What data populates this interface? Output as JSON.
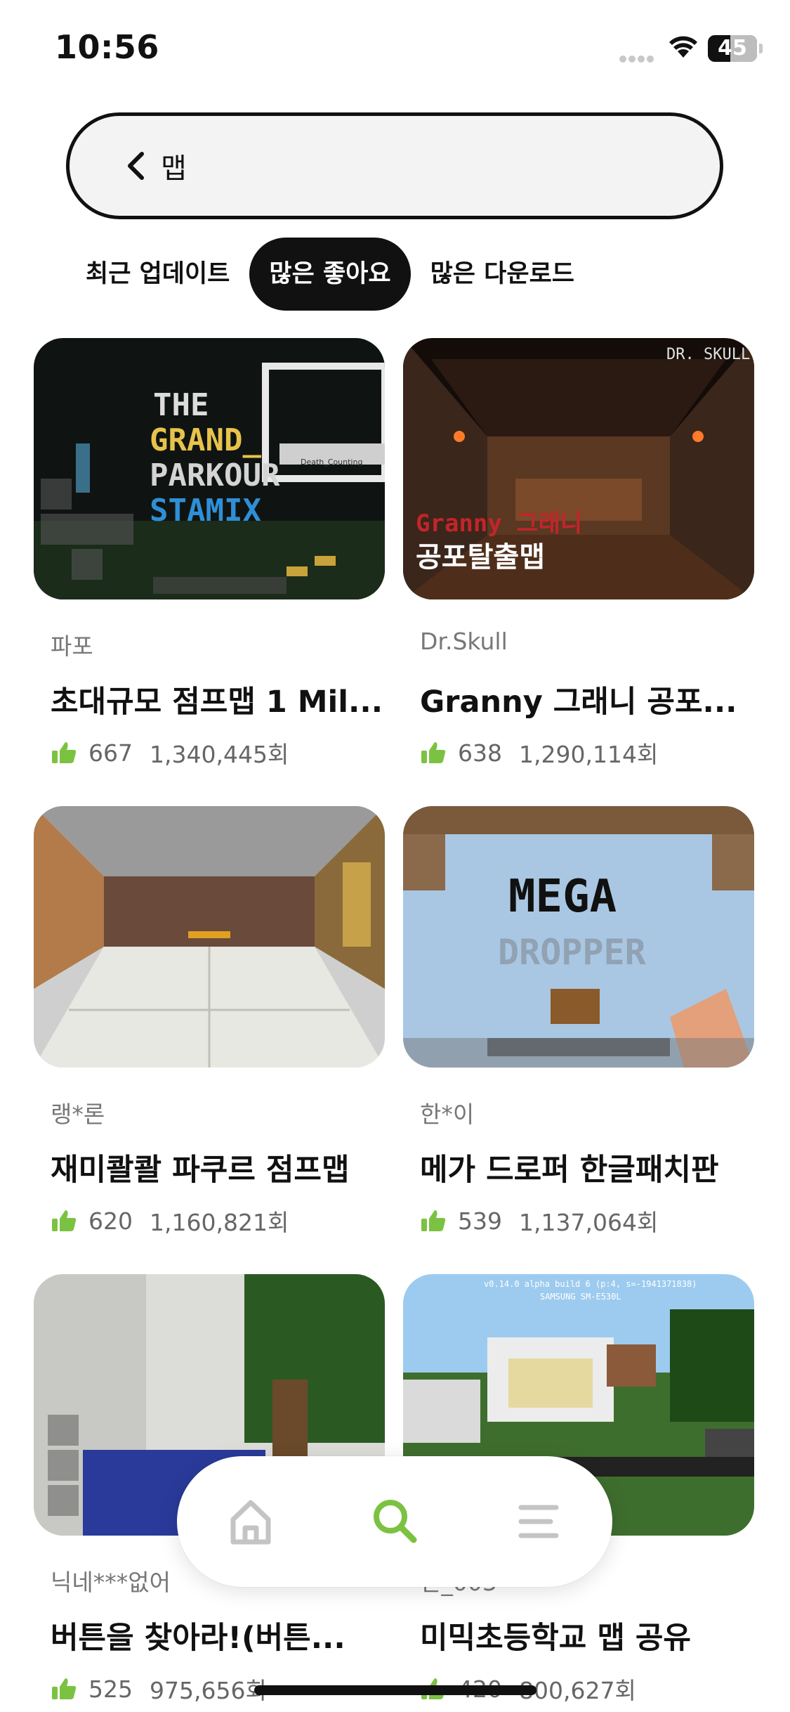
{
  "status": {
    "time": "10:56",
    "battery": "45",
    "battery_level": 0.45
  },
  "search": {
    "query": "맵"
  },
  "tabs": [
    {
      "label": "최근 업데이트",
      "active": false
    },
    {
      "label": "많은 좋아요",
      "active": true
    },
    {
      "label": "많은 다운로드",
      "active": false
    }
  ],
  "cards": [
    {
      "author": "파포",
      "title": "초대규모 점프맵 1 Mil...",
      "likes": "667",
      "views": "1,340,445회",
      "thumb_text": [
        "THE",
        "GRAND_",
        "PARKOUR",
        "STAMIX"
      ],
      "thumb_sign": "Death_Counting"
    },
    {
      "author": "Dr.Skull",
      "title": "Granny 그래니 공포...",
      "likes": "638",
      "views": "1,290,114회",
      "thumb_text": [
        "DR. SKULL",
        "Granny 그래니",
        "공포탈출맵"
      ]
    },
    {
      "author": "랭*론",
      "title": "재미콸콸 파쿠르 점프맵",
      "likes": "620",
      "views": "1,160,821회"
    },
    {
      "author": "한*이",
      "title": "메가 드로퍼 한글패치판",
      "likes": "539",
      "views": "1,137,064회",
      "thumb_text": [
        "MEGA",
        "DROPPER"
      ]
    },
    {
      "author": "닉네***없어",
      "title": "버튼을 찾아라!(버튼...",
      "likes": "525",
      "views": "975,656회"
    },
    {
      "author": "간_003",
      "title": "미믹초등학교 맵 공유",
      "likes": "420",
      "views": "800,627회",
      "thumb_text": [
        "v0.14.0 alpha build 6 (p:4, s=-1941371838)",
        "SAMSUNG SM-E530L"
      ]
    }
  ],
  "colors": {
    "accent": "#7cc242",
    "nav_inactive": "#c4c4c4",
    "active_tab_bg": "#111111"
  },
  "nav": [
    {
      "icon": "home-icon",
      "active": false
    },
    {
      "icon": "search-icon",
      "active": true
    },
    {
      "icon": "menu-icon",
      "active": false
    }
  ]
}
